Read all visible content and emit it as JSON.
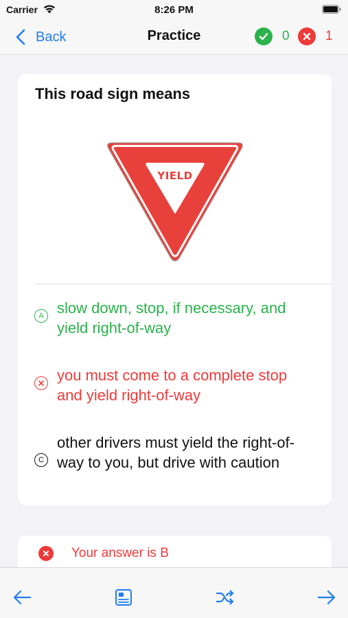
{
  "status_bar": {
    "carrier": "Carrier",
    "time": "8:26 PM"
  },
  "nav": {
    "back_label": "Back",
    "title": "Practice",
    "correct_count": "0",
    "wrong_count": "1"
  },
  "question": {
    "text": "This road sign means",
    "sign_text": "YIELD",
    "options": [
      {
        "letter": "A",
        "text": "slow down, stop, if necessary, and yield right-of-way",
        "state": "correct"
      },
      {
        "letter": "B",
        "text": "you must come to a complete stop and yield right-of-way",
        "state": "wrong"
      },
      {
        "letter": "C",
        "text": "other drivers must yield the right-of-way to you, but drive with caution",
        "state": "neutral"
      }
    ]
  },
  "result": {
    "text": "Your answer is B"
  },
  "toolbar": {
    "icons": [
      "arrow-left-icon",
      "explanation-icon",
      "shuffle-icon",
      "arrow-right-icon"
    ]
  },
  "colors": {
    "accent": "#1f7cf2",
    "correct": "#2bb24c",
    "wrong": "#ee3a3a",
    "sign_red": "#e8413b"
  }
}
